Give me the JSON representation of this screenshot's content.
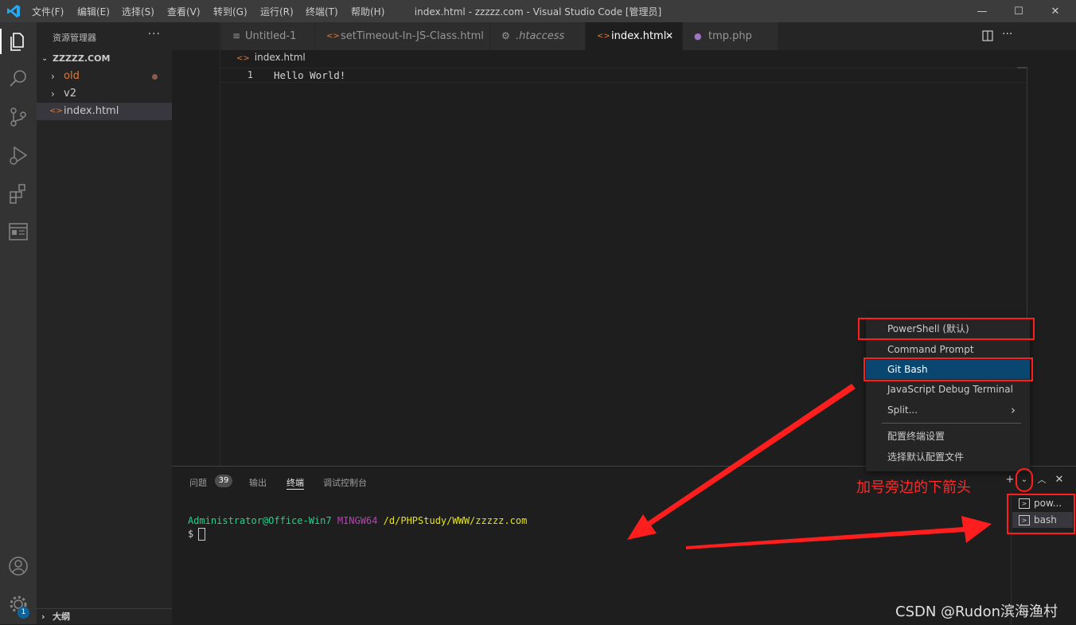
{
  "titlebar": {
    "title": "index.html - zzzzz.com - Visual Studio Code [管理员]",
    "menus": [
      "文件(F)",
      "编辑(E)",
      "选择(S)",
      "查看(V)",
      "转到(G)",
      "运行(R)",
      "终端(T)",
      "帮助(H)"
    ],
    "minimize": "—",
    "maximize": "☐",
    "close": "✕"
  },
  "activity_bar": {
    "accounts_badge": "1"
  },
  "sidebar": {
    "header": "资源管理器",
    "more": "···",
    "root": "ZZZZZ.COM",
    "items": [
      {
        "label": "old",
        "kind": "folder",
        "modified": true
      },
      {
        "label": "v2",
        "kind": "folder",
        "modified": false
      },
      {
        "label": "index.html",
        "kind": "html-file",
        "modified": false
      }
    ],
    "outline": "大纲"
  },
  "tabs": [
    {
      "label": "Untitled-1",
      "icon": "lines-icon",
      "active": false
    },
    {
      "label": "setTimeout-In-JS-Class.html",
      "icon": "html-icon",
      "active": false
    },
    {
      "label": ".htaccess",
      "icon": "gear-icon",
      "active": false
    },
    {
      "label": "index.html",
      "icon": "html-icon",
      "active": true,
      "close": "✕"
    },
    {
      "label": "tmp.php",
      "icon": "php-icon",
      "active": false
    }
  ],
  "editor": {
    "breadcrumb": "index.html",
    "line_number": "1",
    "code": "Hello World!"
  },
  "panel": {
    "tabs": [
      "问题",
      "输出",
      "终端",
      "调试控制台"
    ],
    "problems_count": "39",
    "terminal": {
      "user_host": "Administrator@Office-Win7",
      "env": "MINGW64",
      "path": "/d/PHPStudy/WWW/zzzzz.com",
      "prompt": "$"
    },
    "terminal_list": [
      "pow...",
      "bash"
    ]
  },
  "dropdown": {
    "items": [
      "PowerShell (默认)",
      "Command Prompt",
      "Git Bash",
      "JavaScript Debug Terminal",
      "Split...",
      "配置终端设置",
      "选择默认配置文件"
    ],
    "selected_index": 2,
    "split_arrow": "›"
  },
  "annotation": "加号旁边的下箭头",
  "watermark": "CSDN @Rudon滨海渔村",
  "colors": {
    "accent": "#094771",
    "annotation_red": "#ff1e1e",
    "html_icon": "#e37933",
    "term_green": "#23d18b",
    "term_magenta": "#bc3fbc",
    "term_yellow": "#e5e510"
  }
}
